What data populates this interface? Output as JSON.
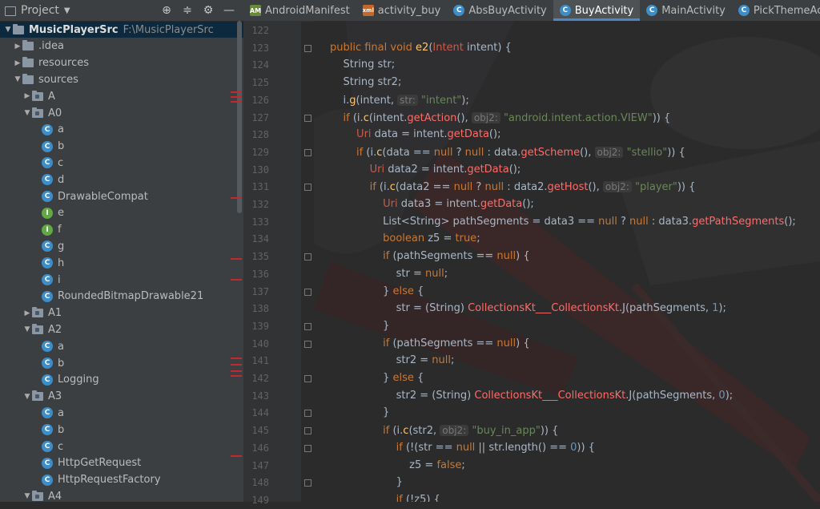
{
  "project": {
    "title": "Project",
    "tree": [
      {
        "label": "MusicPlayerSrc",
        "path": "F:\\MusicPlayerSrc",
        "depth": 0,
        "expanded": true,
        "type": "module",
        "selected": true
      },
      {
        "label": ".idea",
        "depth": 1,
        "expanded": false,
        "type": "folder"
      },
      {
        "label": "resources",
        "depth": 1,
        "expanded": false,
        "type": "folder"
      },
      {
        "label": "sources",
        "depth": 1,
        "expanded": true,
        "type": "folder"
      },
      {
        "label": "A",
        "depth": 2,
        "expanded": false,
        "type": "package"
      },
      {
        "label": "A0",
        "depth": 2,
        "expanded": true,
        "type": "package"
      },
      {
        "label": "a",
        "depth": 3,
        "type": "class"
      },
      {
        "label": "b",
        "depth": 3,
        "type": "class"
      },
      {
        "label": "c",
        "depth": 3,
        "type": "class"
      },
      {
        "label": "d",
        "depth": 3,
        "type": "class"
      },
      {
        "label": "DrawableCompat",
        "depth": 3,
        "type": "class"
      },
      {
        "label": "e",
        "depth": 3,
        "type": "interface"
      },
      {
        "label": "f",
        "depth": 3,
        "type": "interface"
      },
      {
        "label": "g",
        "depth": 3,
        "type": "class"
      },
      {
        "label": "h",
        "depth": 3,
        "type": "class"
      },
      {
        "label": "i",
        "depth": 3,
        "type": "class"
      },
      {
        "label": "RoundedBitmapDrawable21",
        "depth": 3,
        "type": "class"
      },
      {
        "label": "A1",
        "depth": 2,
        "expanded": false,
        "type": "package"
      },
      {
        "label": "A2",
        "depth": 2,
        "expanded": true,
        "type": "package"
      },
      {
        "label": "a",
        "depth": 3,
        "type": "class"
      },
      {
        "label": "b",
        "depth": 3,
        "type": "class"
      },
      {
        "label": "Logging",
        "depth": 3,
        "type": "class"
      },
      {
        "label": "A3",
        "depth": 2,
        "expanded": true,
        "type": "package"
      },
      {
        "label": "a",
        "depth": 3,
        "type": "class"
      },
      {
        "label": "b",
        "depth": 3,
        "type": "class"
      },
      {
        "label": "c",
        "depth": 3,
        "type": "class"
      },
      {
        "label": "HttpGetRequest",
        "depth": 3,
        "type": "class"
      },
      {
        "label": "HttpRequestFactory",
        "depth": 3,
        "type": "class"
      },
      {
        "label": "A4",
        "depth": 2,
        "expanded": true,
        "type": "package"
      }
    ]
  },
  "tabs": [
    {
      "label": "AndroidManifest",
      "icon": "android-manifest-icon",
      "active": false
    },
    {
      "label": "activity_buy",
      "icon": "layout-xml-icon",
      "active": false
    },
    {
      "label": "AbsBuyActivity",
      "icon": "class-icon",
      "active": false
    },
    {
      "label": "BuyActivity",
      "icon": "class-icon",
      "active": true
    },
    {
      "label": "MainActivity",
      "icon": "class-icon",
      "active": false
    },
    {
      "label": "PickThemeActivity",
      "icon": "class-icon",
      "active": false
    }
  ],
  "editor": {
    "first_line_number": 122,
    "lines": [
      [],
      [
        [
          "t-kw",
          "public final void "
        ],
        [
          "t-fn",
          "e2"
        ],
        [
          "",
          "("
        ],
        [
          "t-cls",
          "Intent"
        ],
        [
          "",
          " intent) {"
        ]
      ],
      [
        [
          "",
          "    String "
        ],
        [
          "",
          "str"
        ],
        [
          "",
          ";"
        ]
      ],
      [
        [
          "",
          "    String "
        ],
        [
          "",
          "str2"
        ],
        [
          "",
          ";"
        ]
      ],
      [
        [
          "",
          "    i."
        ],
        [
          "t-fn",
          "g"
        ],
        [
          "",
          "(intent, "
        ],
        [
          "t-hint",
          "str:"
        ],
        [
          "t-str",
          " \"intent\""
        ],
        [
          "",
          ");"
        ]
      ],
      [
        [
          "t-kw",
          "    if "
        ],
        [
          "",
          "(i."
        ],
        [
          "t-fn",
          "c"
        ],
        [
          "",
          "(intent."
        ],
        [
          "t-meth",
          "getAction"
        ],
        [
          "",
          "(), "
        ],
        [
          "t-hint",
          "obj2:"
        ],
        [
          "t-str",
          " \"android.intent.action.VIEW\""
        ],
        [
          "",
          ")) {"
        ]
      ],
      [
        [
          "t-cls",
          "        Uri"
        ],
        [
          "",
          " data = intent."
        ],
        [
          "t-meth",
          "getData"
        ],
        [
          "",
          "();"
        ]
      ],
      [
        [
          "t-kw",
          "        if "
        ],
        [
          "",
          "(i."
        ],
        [
          "t-fn",
          "c"
        ],
        [
          "",
          "(data == "
        ],
        [
          "t-kw",
          "null"
        ],
        [
          "",
          " ? "
        ],
        [
          "t-kw",
          "null"
        ],
        [
          "",
          " : data."
        ],
        [
          "t-meth",
          "getScheme"
        ],
        [
          "",
          "(), "
        ],
        [
          "t-hint",
          "obj2:"
        ],
        [
          "t-str",
          " \"stellio\""
        ],
        [
          "",
          ")) {"
        ]
      ],
      [
        [
          "t-cls",
          "            Uri"
        ],
        [
          "",
          " data2 = intent."
        ],
        [
          "t-meth",
          "getData"
        ],
        [
          "",
          "();"
        ]
      ],
      [
        [
          "t-kw",
          "            if "
        ],
        [
          "",
          "(i."
        ],
        [
          "t-fn",
          "c"
        ],
        [
          "",
          "(data2 == "
        ],
        [
          "t-kw",
          "null"
        ],
        [
          "",
          " ? "
        ],
        [
          "t-kw",
          "null"
        ],
        [
          "",
          " : data2."
        ],
        [
          "t-meth",
          "getHost"
        ],
        [
          "",
          "(), "
        ],
        [
          "t-hint",
          "obj2:"
        ],
        [
          "t-str",
          " \"player\""
        ],
        [
          "",
          ")) {"
        ]
      ],
      [
        [
          "t-cls",
          "                Uri"
        ],
        [
          "",
          " data3 = intent."
        ],
        [
          "t-meth",
          "getData"
        ],
        [
          "",
          "();"
        ]
      ],
      [
        [
          "",
          "                List<String> pathSegments = data3 == "
        ],
        [
          "t-kw",
          "null"
        ],
        [
          "",
          " ? "
        ],
        [
          "t-kw",
          "null"
        ],
        [
          "",
          " : data3."
        ],
        [
          "t-meth",
          "getPathSegments"
        ],
        [
          "",
          "();"
        ]
      ],
      [
        [
          "t-kw",
          "                boolean "
        ],
        [
          "",
          "z5 = "
        ],
        [
          "t-kw",
          "true"
        ],
        [
          "",
          ";"
        ]
      ],
      [
        [
          "t-kw",
          "                if "
        ],
        [
          "",
          "(pathSegments == "
        ],
        [
          "t-kw",
          "null"
        ],
        [
          "",
          ") {"
        ]
      ],
      [
        [
          "",
          "                    str = "
        ],
        [
          "t-kw",
          "null"
        ],
        [
          "",
          ";"
        ]
      ],
      [
        [
          "",
          "                } "
        ],
        [
          "t-kw",
          "else "
        ],
        [
          "",
          "{"
        ]
      ],
      [
        [
          "",
          "                    str = (String) "
        ],
        [
          "t-err",
          "CollectionsKt___CollectionsKt"
        ],
        [
          "",
          ".J(pathSegments, "
        ],
        [
          "t-num",
          "1"
        ],
        [
          "",
          ");"
        ]
      ],
      [
        [
          "",
          "                }"
        ]
      ],
      [
        [
          "t-kw",
          "                if "
        ],
        [
          "",
          "(pathSegments == "
        ],
        [
          "t-kw",
          "null"
        ],
        [
          "",
          ") {"
        ]
      ],
      [
        [
          "",
          "                    str2 = "
        ],
        [
          "t-kw",
          "null"
        ],
        [
          "",
          ";"
        ]
      ],
      [
        [
          "",
          "                } "
        ],
        [
          "t-kw",
          "else "
        ],
        [
          "",
          "{"
        ]
      ],
      [
        [
          "",
          "                    str2 = (String) "
        ],
        [
          "t-err",
          "CollectionsKt___CollectionsKt"
        ],
        [
          "",
          ".J(pathSegments, "
        ],
        [
          "t-num",
          "0"
        ],
        [
          "",
          ");"
        ]
      ],
      [
        [
          "",
          "                }"
        ]
      ],
      [
        [
          "t-kw",
          "                if "
        ],
        [
          "",
          "(i."
        ],
        [
          "t-fn",
          "c"
        ],
        [
          "",
          "(str2, "
        ],
        [
          "t-hint",
          "obj2:"
        ],
        [
          "t-str",
          " \"buy_in_app\""
        ],
        [
          "",
          ")) {"
        ]
      ],
      [
        [
          "t-kw",
          "                    if "
        ],
        [
          "",
          "(!(str == "
        ],
        [
          "t-kw",
          "null"
        ],
        [
          "",
          " || str.length() == "
        ],
        [
          "t-num",
          "0"
        ],
        [
          "",
          ")) {"
        ]
      ],
      [
        [
          "",
          "                        z5 = "
        ],
        [
          "t-kw",
          "false"
        ],
        [
          "",
          ";"
        ]
      ],
      [
        [
          "",
          "                    }"
        ]
      ],
      [
        [
          "t-kw",
          "                    if "
        ],
        [
          "",
          "(!z5) {"
        ]
      ]
    ]
  },
  "colors": {
    "accent": "#4a88c7",
    "error_marker": "#c2282d",
    "background": "#2b2b2b"
  }
}
